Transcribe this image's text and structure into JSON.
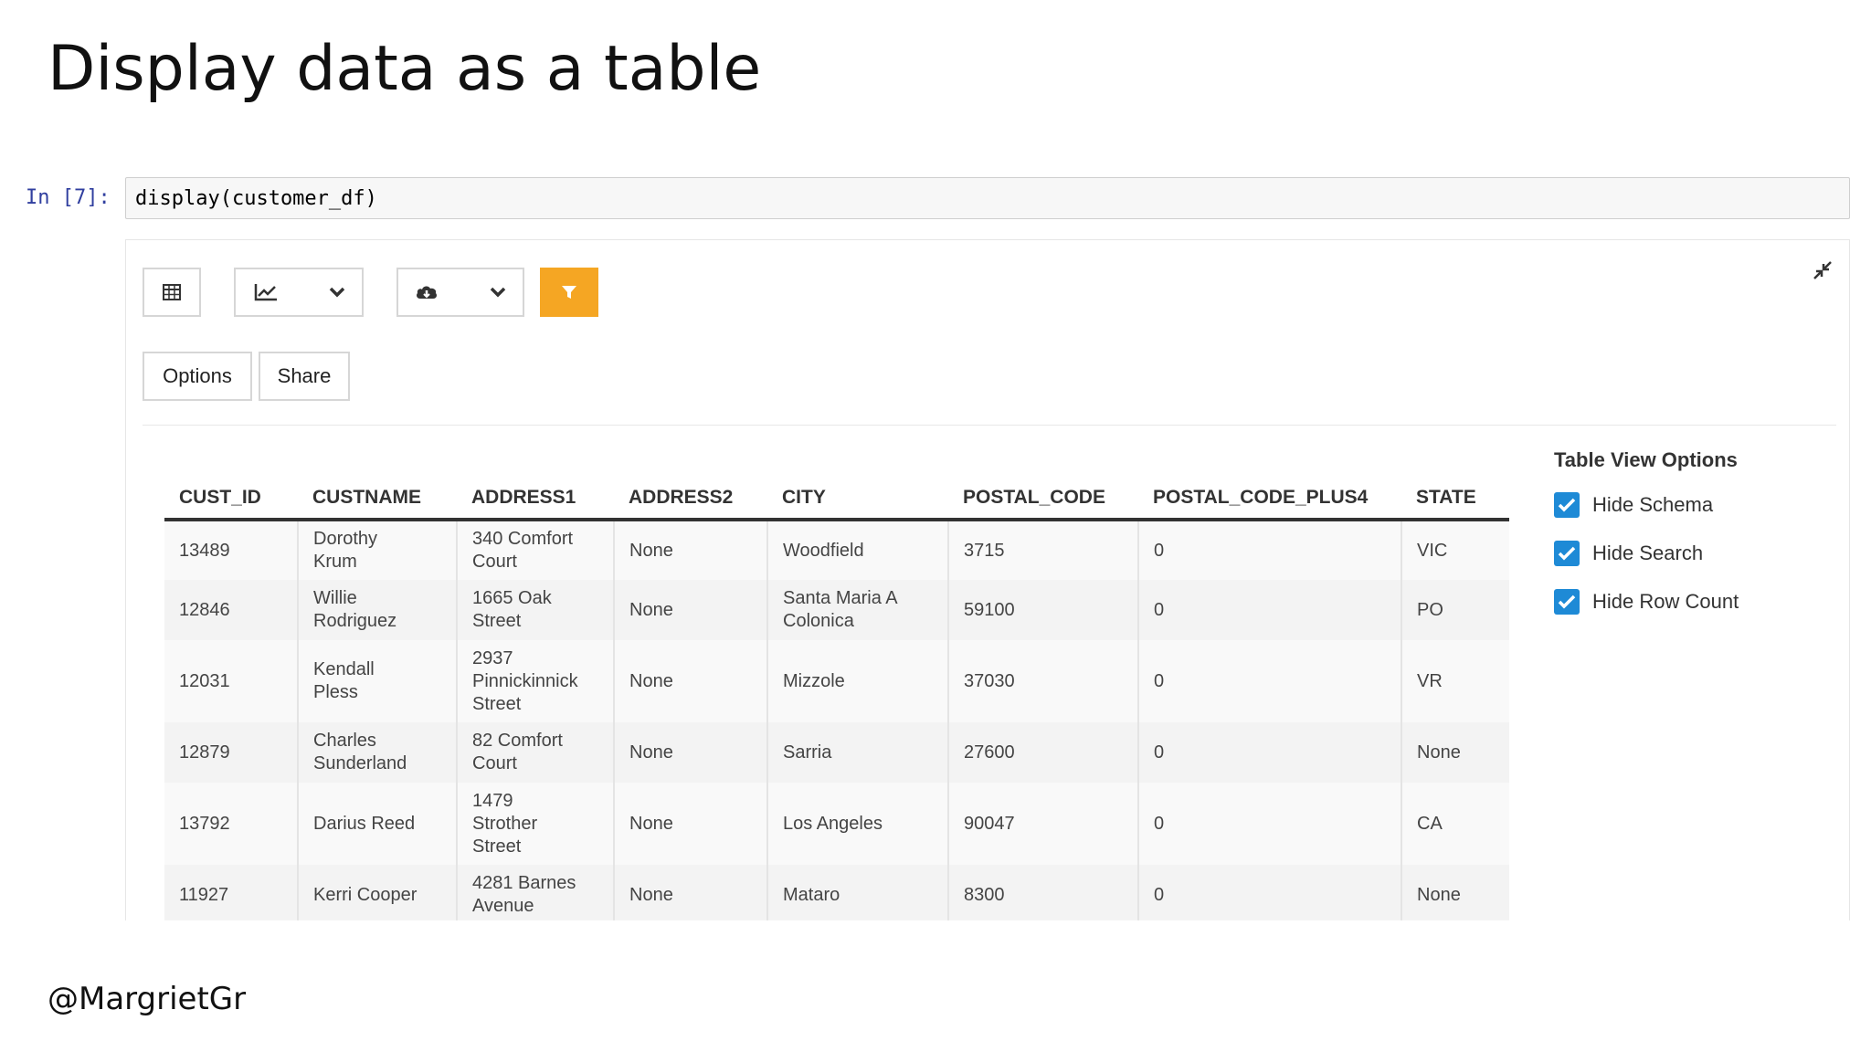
{
  "slide": {
    "title": "Display data as a table",
    "footer": "@MargrietGr"
  },
  "cell": {
    "prompt": "In [7]:",
    "code": "display(customer_df)"
  },
  "toolbar": {
    "table_view": "table-icon",
    "chart_menu": [
      "line-chart-icon",
      "chevron-down-icon"
    ],
    "download_menu": [
      "cloud-download-icon",
      "chevron-down-icon"
    ],
    "filter": "filter-icon",
    "accent_color": "#f5a623",
    "options_label": "Options",
    "share_label": "Share"
  },
  "table": {
    "columns": [
      "CUST_ID",
      "CUSTNAME",
      "ADDRESS1",
      "ADDRESS2",
      "CITY",
      "POSTAL_CODE",
      "POSTAL_CODE_PLUS4",
      "STATE"
    ],
    "rows": [
      [
        "13489",
        "Dorothy\nKrum",
        "340 Comfort\nCourt",
        "None",
        "Woodfield",
        "3715",
        "0",
        "VIC"
      ],
      [
        "12846",
        "Willie\nRodriguez",
        "1665 Oak\nStreet",
        "None",
        "Santa Maria A\nColonica",
        "59100",
        "0",
        "PO"
      ],
      [
        "12031",
        "Kendall\nPless",
        "2937\nPinnickinnick\nStreet",
        "None",
        "Mizzole",
        "37030",
        "0",
        "VR"
      ],
      [
        "12879",
        "Charles\nSunderland",
        "82 Comfort\nCourt",
        "None",
        "Sarria",
        "27600",
        "0",
        "None"
      ],
      [
        "13792",
        "Darius Reed",
        "1479\nStrother\nStreet",
        "None",
        "Los Angeles",
        "90047",
        "0",
        "CA"
      ],
      [
        "11927",
        "Kerri Cooper",
        "4281 Barnes\nAvenue",
        "None",
        "Mataro",
        "8300",
        "0",
        "None"
      ]
    ]
  },
  "view_options": {
    "title": "Table View Options",
    "items": [
      {
        "label": "Hide Schema",
        "checked": true
      },
      {
        "label": "Hide Search",
        "checked": true
      },
      {
        "label": "Hide Row Count",
        "checked": true
      }
    ],
    "check_color": "#1e8ad6"
  }
}
